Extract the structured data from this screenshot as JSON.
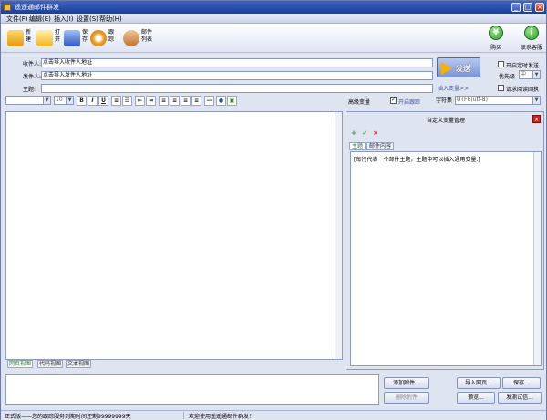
{
  "window": {
    "title": "遥遥通邮件群发"
  },
  "menu": [
    "文件(F)",
    "编辑(E)",
    "插入(I)",
    "设置(S)",
    "帮助(H)"
  ],
  "toolbar": {
    "tools": [
      {
        "icon": "new-icon",
        "label": "新建"
      },
      {
        "icon": "open-icon",
        "label": "打开"
      },
      {
        "icon": "save-icon",
        "label": "保存"
      },
      {
        "icon": "track-icon",
        "label": "跟踪"
      },
      {
        "icon": "mail-list-icon",
        "label": "邮件列表"
      }
    ],
    "right": [
      {
        "icon": "cart-icon",
        "label": "购买"
      },
      {
        "icon": "support-icon",
        "label": "联系客服"
      }
    ]
  },
  "header": {
    "recipient_label": "收件人:",
    "recipient_value": "点击导入收件人地址",
    "sender_label": "发件人:",
    "sender_value": "点击导入发件人地址",
    "subject_label": "主题:",
    "subject_value": "",
    "insert_var_link": "插入变量>>",
    "send_label": "发送",
    "schedule_label": "开启定时发送",
    "priority_label": "优先级",
    "priority_value": "中",
    "read_receipt_label": "请求阅读回执",
    "advanced_var_label": "高级变量",
    "enable_track_label": "开启跟踪",
    "charset_label": "字符集",
    "charset_value": "UTF8(utf-8)"
  },
  "format": {
    "font_size": "10",
    "buttons": [
      "B",
      "I",
      "U"
    ]
  },
  "editor": {
    "tabs": [
      "网页视图",
      "代码视图",
      "文本视图"
    ]
  },
  "var_panel": {
    "title": "自定义变量管理",
    "tabs": [
      "主题",
      "邮件内容"
    ],
    "content": "[每行代表一个邮件主题，主题中可以插入通用变量.]"
  },
  "bottom": {
    "add_attachment": "添加附件...",
    "delete_attachment": "删除附件",
    "import_page": "导入网页...",
    "save": "保存...",
    "preview": "预览...",
    "send_test": "发测试信..."
  },
  "status": {
    "left": "正式版——您的跟踪服务到期时间还剩99999999天",
    "right": "欢迎使用遥遥通邮件群发！"
  }
}
